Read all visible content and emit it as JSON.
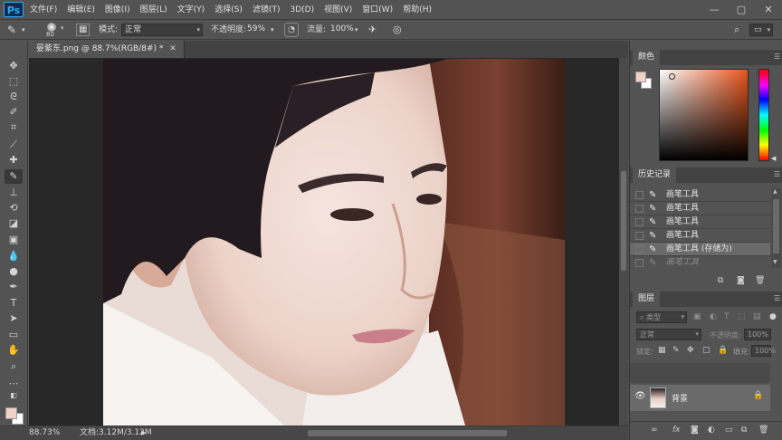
{
  "app": {
    "logo": "Ps"
  },
  "menu": [
    "文件(F)",
    "编辑(E)",
    "图像(I)",
    "图层(L)",
    "文字(Y)",
    "选择(S)",
    "滤镜(T)",
    "3D(D)",
    "视图(V)",
    "窗口(W)",
    "帮助(H)"
  ],
  "window_controls": {
    "minimize": "—",
    "restore": "▢",
    "close": "✕"
  },
  "options": {
    "brush_size": "80",
    "mode_label": "模式:",
    "mode_value": "正常",
    "opacity_label": "不透明度:",
    "opacity_value": "59%",
    "flow_label": "流量:",
    "flow_value": "100%"
  },
  "document": {
    "tab_label": "晏紫东.png @ 88.7%(RGB/8#) *",
    "close": "✕"
  },
  "status": {
    "zoom": "88.73%",
    "doc": "文档:3.12M/3.12M"
  },
  "panels": {
    "color": {
      "title": "颜色",
      "fg": "#f0d2c4",
      "bg": "#ffffff"
    },
    "history": {
      "title": "历史记录",
      "items": [
        {
          "label": "画笔工具",
          "state": "normal"
        },
        {
          "label": "画笔工具",
          "state": "normal"
        },
        {
          "label": "画笔工具",
          "state": "normal"
        },
        {
          "label": "画笔工具",
          "state": "normal"
        },
        {
          "label": "画笔工具 (存储为)",
          "state": "selected"
        },
        {
          "label": "画笔工具",
          "state": "undone"
        }
      ]
    },
    "layers": {
      "title": "图层",
      "filter_placeholder": "类型",
      "blend_mode": "正常",
      "opacity_label": "不透明度:",
      "opacity_value": "100%",
      "lock_label": "锁定:",
      "fill_label": "填充:",
      "fill_value": "100%",
      "layer_name": "背景",
      "bottom_fx": "fx"
    }
  }
}
